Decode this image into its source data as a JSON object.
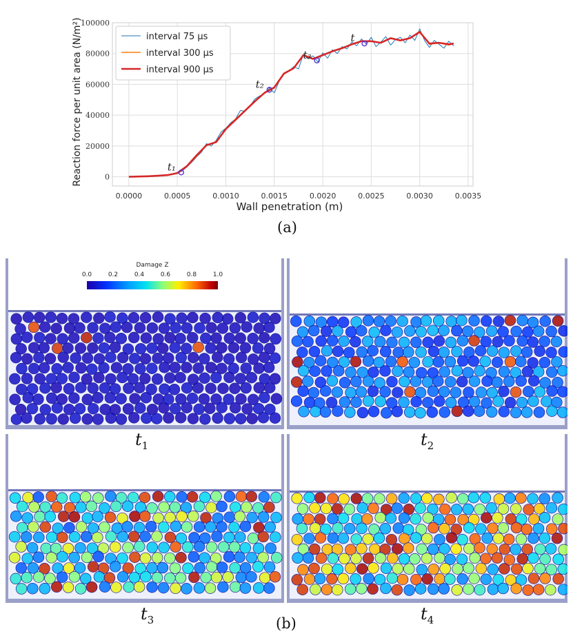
{
  "chart_data": {
    "type": "line",
    "xlabel": "Wall penetration (m)",
    "ylabel": "Reaction force per unit area (N/m²)",
    "xlim": [
      -0.00017,
      0.00355
    ],
    "ylim": [
      -6000,
      100000
    ],
    "x_ticks": [
      "0.0000",
      "0.0005",
      "0.0010",
      "0.0015",
      "0.0020",
      "0.0025",
      "0.0030",
      "0.0035"
    ],
    "y_ticks": [
      "0",
      "20000",
      "40000",
      "60000",
      "80000",
      "100000"
    ],
    "grid": true,
    "legend_position": "top-left",
    "series": [
      {
        "name": "interval 75 μs",
        "color": "#1f77b4",
        "width": 1,
        "x": [
          0,
          0.0001,
          0.0002,
          0.0003,
          0.0004,
          0.0005,
          0.00055,
          0.0006,
          0.00065,
          0.0007,
          0.00075,
          0.0008,
          0.00085,
          0.0009,
          0.00095,
          0.001,
          0.00105,
          0.0011,
          0.00115,
          0.0012,
          0.00125,
          0.0013,
          0.00135,
          0.0014,
          0.00145,
          0.0015,
          0.00155,
          0.0016,
          0.00165,
          0.0017,
          0.00175,
          0.0018,
          0.00185,
          0.0019,
          0.00195,
          0.002,
          0.00205,
          0.0021,
          0.00215,
          0.0022,
          0.00225,
          0.0023,
          0.00235,
          0.0024,
          0.00245,
          0.0025,
          0.00255,
          0.0026,
          0.00265,
          0.0027,
          0.00275,
          0.0028,
          0.00285,
          0.0029,
          0.00295,
          0.003,
          0.00305,
          0.0031,
          0.00315,
          0.0032,
          0.00325,
          0.0033,
          0.00335
        ],
        "y": [
          0,
          100,
          300,
          600,
          1000,
          2200,
          3800,
          6500,
          9500,
          13000,
          16000,
          21500,
          20000,
          23500,
          29000,
          31500,
          35000,
          37500,
          43000,
          42500,
          46000,
          50500,
          52500,
          54000,
          57500,
          54500,
          62000,
          67500,
          68500,
          71500,
          70000,
          79500,
          76500,
          78500,
          74500,
          80500,
          77000,
          82500,
          80000,
          84500,
          83000,
          87500,
          85000,
          89500,
          86000,
          90500,
          84500,
          87500,
          91000,
          85500,
          89000,
          90500,
          87000,
          92000,
          88500,
          96000,
          88500,
          84000,
          88500,
          86000,
          83500,
          88000,
          85000
        ]
      },
      {
        "name": "interval 300 μs",
        "color": "#ff7f0e",
        "width": 1.6,
        "x": [
          0,
          0.0001,
          0.0002,
          0.0003,
          0.0004,
          0.0005,
          0.0006,
          0.0007,
          0.0008,
          0.0009,
          0.001,
          0.0011,
          0.0012,
          0.0013,
          0.0014,
          0.0015,
          0.0016,
          0.0017,
          0.0018,
          0.0019,
          0.002,
          0.0021,
          0.0022,
          0.0023,
          0.0024,
          0.0025,
          0.0026,
          0.0027,
          0.0028,
          0.0029,
          0.003,
          0.0031,
          0.0032,
          0.0033,
          0.00335
        ],
        "y": [
          0,
          150,
          350,
          650,
          1100,
          2300,
          6800,
          13500,
          20500,
          22500,
          31000,
          37500,
          43000,
          49000,
          54500,
          57500,
          67000,
          70500,
          79000,
          76500,
          79000,
          81500,
          83500,
          86000,
          88000,
          88000,
          87000,
          90000,
          88500,
          90000,
          94500,
          86000,
          87000,
          85500,
          86500
        ]
      },
      {
        "name": "interval 900 μs",
        "color": "#d62728",
        "width": 2.6,
        "x": [
          0,
          0.0001,
          0.0002,
          0.0003,
          0.0004,
          0.0005,
          0.0006,
          0.0007,
          0.0008,
          0.0009,
          0.001,
          0.0011,
          0.0012,
          0.0013,
          0.0014,
          0.0015,
          0.0016,
          0.0017,
          0.0018,
          0.0019,
          0.002,
          0.0021,
          0.0022,
          0.0023,
          0.0024,
          0.0025,
          0.0026,
          0.0027,
          0.0028,
          0.0029,
          0.003,
          0.0031,
          0.0032,
          0.0033,
          0.00335
        ],
        "y": [
          0,
          150,
          350,
          650,
          1100,
          2400,
          7000,
          14000,
          20500,
          22500,
          31000,
          37000,
          43000,
          49000,
          54500,
          58000,
          67000,
          70500,
          79000,
          76500,
          79000,
          81500,
          83500,
          86000,
          88000,
          88000,
          87000,
          90000,
          88500,
          90000,
          94000,
          86500,
          87000,
          86000,
          86500
        ]
      }
    ],
    "annotations": [
      {
        "label": "t₁",
        "x": 0.00054,
        "y": 2800
      },
      {
        "label": "t₂",
        "x": 0.00145,
        "y": 56500
      },
      {
        "label": "t₃",
        "x": 0.00194,
        "y": 75500
      },
      {
        "label": "t",
        "x": 0.00243,
        "y": 86500
      }
    ]
  },
  "captions": {
    "a": "(a)",
    "b": "(b)"
  },
  "colorbar": {
    "title": "Damage Z",
    "ticks": [
      "0.0",
      "0.2",
      "0.4",
      "0.6",
      "0.8",
      "1.0"
    ]
  },
  "panels": [
    {
      "id": "t1",
      "label": "t",
      "sub": "1",
      "damage_level": 0.05
    },
    {
      "id": "t2",
      "label": "t",
      "sub": "2",
      "damage_level": 0.3
    },
    {
      "id": "t3",
      "label": "t",
      "sub": "3",
      "damage_level": 0.55
    },
    {
      "id": "t4",
      "label": "t",
      "sub": "4",
      "damage_level": 0.7
    }
  ],
  "colors": {
    "deep_blue": "#1f1fb0",
    "grid": "#dddddd",
    "marker": "#5a2fd0"
  }
}
